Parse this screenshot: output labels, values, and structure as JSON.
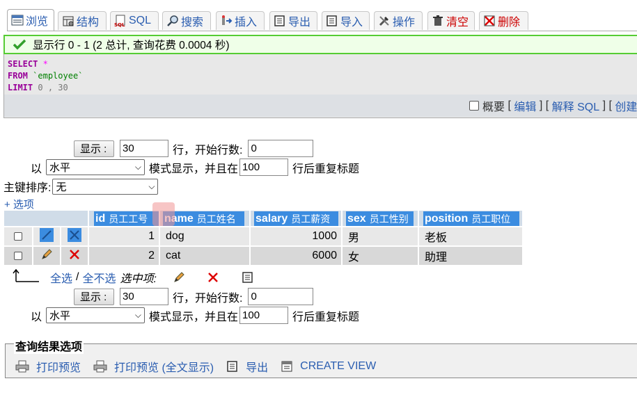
{
  "tabs": [
    {
      "label": "浏览",
      "icon": "browse-icon",
      "active": true
    },
    {
      "label": "结构",
      "icon": "structure-icon"
    },
    {
      "label": "SQL",
      "icon": "sql-icon"
    },
    {
      "label": "搜索",
      "icon": "search-icon"
    },
    {
      "label": "插入",
      "icon": "insert-icon"
    },
    {
      "label": "导出",
      "icon": "export-icon"
    },
    {
      "label": "导入",
      "icon": "import-icon"
    },
    {
      "label": "操作",
      "icon": "operations-icon"
    },
    {
      "label": "清空",
      "icon": "empty-icon",
      "danger": true
    },
    {
      "label": "删除",
      "icon": "drop-icon",
      "danger": true
    }
  ],
  "message": "显示行 0 - 1 (2 总计, 查询花费 0.0004 秒)",
  "sql": {
    "line1_kw": "SELECT",
    "line1_op": "*",
    "line2_kw": "FROM",
    "line2_id": "`employee`",
    "line3_kw": "LIMIT",
    "line3_a": "0",
    "line3_comma": ",",
    "line3_b": "30"
  },
  "sql_links": {
    "profile": "概要",
    "edit": "编辑",
    "explain": "解释 SQL",
    "create": "创建",
    "lb": "[",
    "rb": "]"
  },
  "nav": {
    "show_label": "显示 :",
    "rows_value": "30",
    "rows_text": "行，开始行数:",
    "start_value": "0",
    "in_text": "以",
    "mode_value": "水平",
    "mode_text": "模式显示，并且在",
    "repeat_value": "100",
    "repeat_text": "行后重复标题"
  },
  "sort": {
    "label": "主键排序:",
    "value": "无"
  },
  "options_link": "+ 选项",
  "columns": [
    {
      "name": "id",
      "comment": "员工工号"
    },
    {
      "name": "name",
      "comment": "员工姓名"
    },
    {
      "name": "salary",
      "comment": "员工薪资"
    },
    {
      "name": "sex",
      "comment": "员工性别"
    },
    {
      "name": "position",
      "comment": "员工职位"
    }
  ],
  "rows": [
    {
      "id": "1",
      "name": "dog",
      "salary": "1000",
      "sex": "男",
      "position": "老板"
    },
    {
      "id": "2",
      "name": "cat",
      "salary": "6000",
      "sex": "女",
      "position": "助理"
    }
  ],
  "bulk": {
    "check_all": "全选",
    "sep": "/",
    "uncheck_all": "全不选",
    "with_selected": "选中项:"
  },
  "query_options": {
    "legend": "查询结果选项",
    "print": "打印预览",
    "print_full": "打印预览 (全文显示)",
    "export": "导出",
    "create_view": "CREATE VIEW"
  },
  "colors": {
    "accent": "#3b8ce0",
    "link": "#2a5db0",
    "success_border": "#55cc33",
    "danger": "#cc0000"
  }
}
